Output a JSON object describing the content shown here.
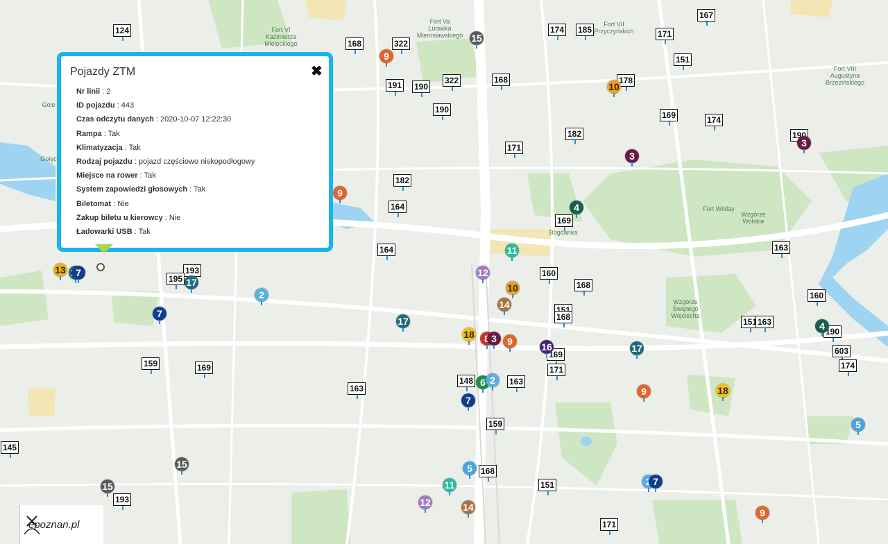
{
  "popup": {
    "title": "Pojazdy ZTM",
    "rows": [
      {
        "key": "Nr linii",
        "value": "2"
      },
      {
        "key": "ID pojazdu",
        "value": "443"
      },
      {
        "key": "Czas odczytu danych",
        "value": "2020-10-07 12:22:30"
      },
      {
        "key": "Rampa",
        "value": "Tak"
      },
      {
        "key": "Klimatyzacja",
        "value": "Tak"
      },
      {
        "key": "Rodzaj pojazdu",
        "value": "pojazd częściowo niskopodłogowy"
      },
      {
        "key": "Miejsce na rower",
        "value": "Tak"
      },
      {
        "key": "System zapowiedzi głosowych",
        "value": "Tak"
      },
      {
        "key": "Biletomat",
        "value": "Nie"
      },
      {
        "key": "Zakup biletu u kierowcy",
        "value": "Nie"
      },
      {
        "key": "Ładowarki USB",
        "value": "Tak"
      }
    ],
    "close_icon": "close-icon"
  },
  "map_labels": [
    "Fort VI\nKazimierza\nMielęckiego",
    "Fort Va\nLudwika\nMierosławskiego",
    "Fort VII\nPrzyczyńskich",
    "Fort VIII\nAugustyna\nBrzezińskiego",
    "Fort Wilday",
    "Wzgórze\nWolskie",
    "Bogdanka",
    "Wzgórze\nŚwiętego\nWojciecha",
    "Gole",
    "Golęc"
  ],
  "watermark": {
    "text": "epoznan.pl"
  },
  "colors": {
    "popup_border": "#19b4ec",
    "route_pin": "#2a8fd8"
  },
  "buses": [
    "124",
    "168",
    "322",
    "174",
    "185",
    "167",
    "171",
    "151",
    "191",
    "190",
    "322",
    "168",
    "178",
    "190",
    "182",
    "169",
    "174",
    "190",
    "171",
    "182",
    "164",
    "169",
    "164",
    "163",
    "160",
    "168",
    "151",
    "168",
    "160",
    "193",
    "195",
    "151",
    "163",
    "190",
    "169",
    "603",
    "171",
    "174",
    "159",
    "169",
    "148",
    "163",
    "163",
    "159",
    "145",
    "168",
    "151",
    "193",
    "171"
  ],
  "trams": [
    "15",
    "9",
    "9",
    "3",
    "3",
    "4",
    "11",
    "10",
    "12",
    "10",
    "14",
    "2",
    "17",
    "17",
    "7",
    "17",
    "18",
    "8",
    "3",
    "9",
    "16",
    "6",
    "7",
    "2",
    "17",
    "4",
    "9",
    "18",
    "5",
    "5",
    "2",
    "7",
    "15",
    "15",
    "11",
    "12",
    "14",
    "9",
    "13",
    "7"
  ]
}
